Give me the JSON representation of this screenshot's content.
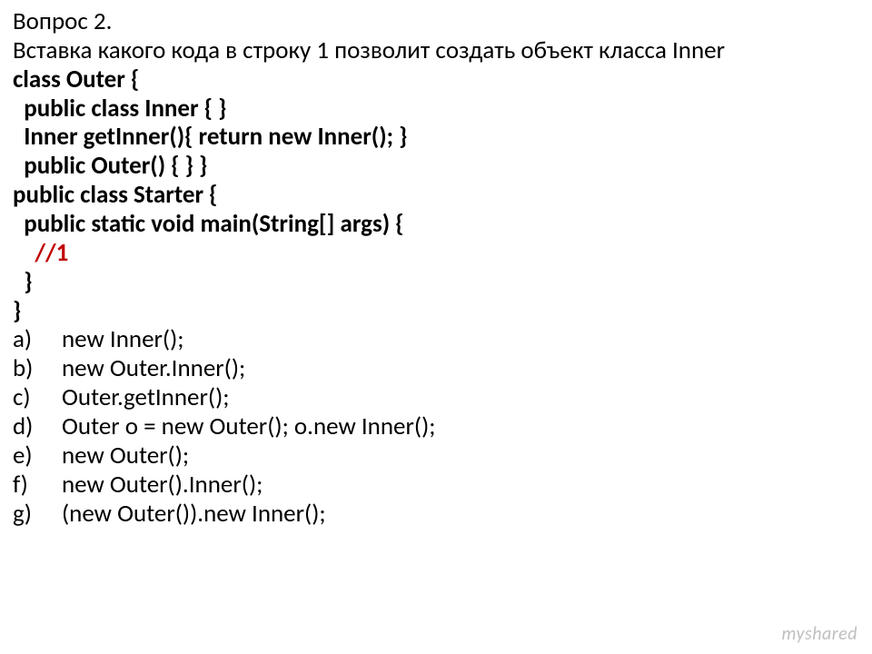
{
  "question": {
    "title": "Вопрос 2.",
    "prompt": "Вставка какого кода в строку 1 позволит создать объект класса Inner"
  },
  "code": {
    "l1": "class Outer {",
    "l2": "  public class Inner { }",
    "l3": "  Inner getInner(){ return new Inner(); }",
    "l4": "  public Outer() { } }",
    "l5": "public class Starter {",
    "l6": "  public static void main(String[] args) {",
    "l7": "    //1",
    "l8": "  }",
    "l9": "}"
  },
  "answers": [
    {
      "letter": "a)",
      "text": "new Inner();"
    },
    {
      "letter": "b)",
      "text": "new Outer.Inner();"
    },
    {
      "letter": "c)",
      "text": "Outer.getInner();"
    },
    {
      "letter": "d)",
      "text": "Outer o = new Outer(); o.new Inner();"
    },
    {
      "letter": "e)",
      "text": "new Outer();"
    },
    {
      "letter": "f)",
      "text": "new Outer().Inner();"
    },
    {
      "letter": "g)",
      "text": "(new Outer()).new Inner();"
    }
  ],
  "watermark": {
    "my": "my",
    "shared": "shared"
  }
}
